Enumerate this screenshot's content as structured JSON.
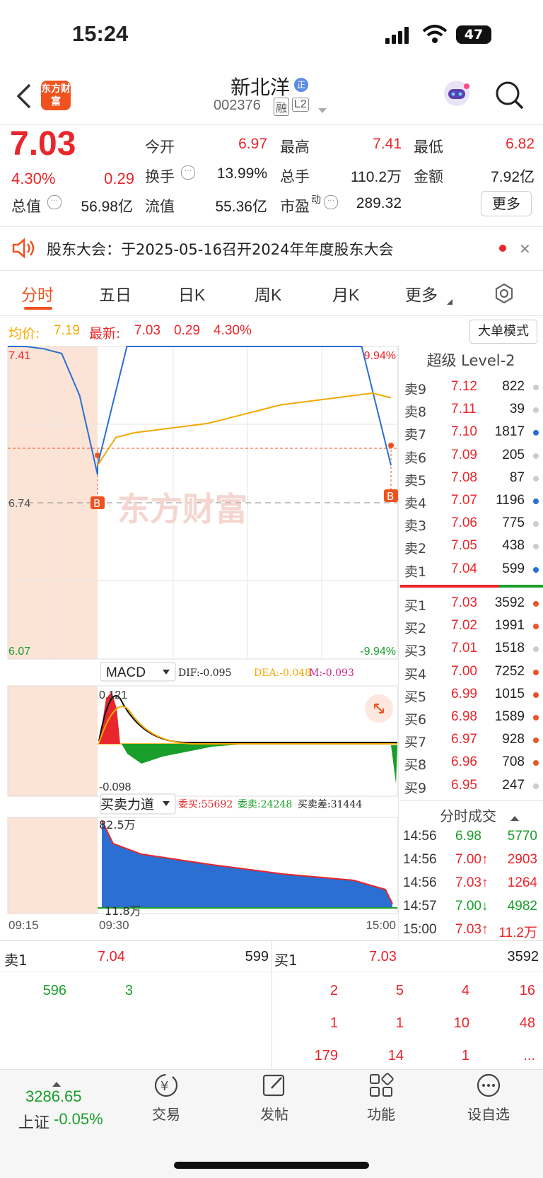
{
  "status_bar": {
    "time": "15:24",
    "battery": "47"
  },
  "header": {
    "logo": "东方财富",
    "name": "新北洋",
    "badge": "正",
    "code": "002376",
    "tag1": "融",
    "tag2": "L2"
  },
  "quote": {
    "price": "7.03",
    "pct": "4.30%",
    "change": "0.29",
    "open_label": "今开",
    "open": "6.97",
    "high_label": "最高",
    "high": "7.41",
    "low_label": "最低",
    "low": "6.82",
    "turnover_label": "换手",
    "turnover": "13.99%",
    "volume_label": "总手",
    "volume": "110.2万",
    "amount_label": "金额",
    "amount": "7.92亿",
    "mktcap_label": "总值",
    "mktcap": "56.98亿",
    "float_label": "流值",
    "float": "55.36亿",
    "pe_label": "市盈",
    "pe_sup": "动",
    "pe": "289.32",
    "more": "更多"
  },
  "notice": {
    "text": "股东大会：于2025-05-16召开2024年年度股东大会"
  },
  "tabs": [
    "分时",
    "五日",
    "日K",
    "周K",
    "月K",
    "更多"
  ],
  "info_line": {
    "avg_label": "均价:",
    "avg": "7.19",
    "latest_label": "最新:",
    "latest": "7.03",
    "chg": "0.29",
    "pct": "4.30%",
    "big_order_button": "大单模式"
  },
  "chart_data": {
    "type": "line",
    "ylim": [
      6.07,
      7.41
    ],
    "y_top_label": "7.41",
    "y_mid_label": "6.74",
    "y_bottom_label": "6.07",
    "pct_top": "9.94%",
    "pct_bottom": "-9.94%",
    "x_labels": [
      "09:15",
      "09:30",
      "15:00"
    ],
    "watermark": "东方财富",
    "price_series": [
      7.41,
      7.41,
      7.4,
      7.38,
      7.2,
      6.86,
      6.9,
      7.41,
      7.41,
      7.41,
      7.41,
      7.41,
      7.41,
      7.41,
      7.41,
      7.41,
      6.9
    ],
    "avg_series": [
      6.9,
      7.02,
      7.04,
      7.05,
      7.06,
      7.07,
      7.08,
      7.1,
      7.12,
      7.14,
      7.16,
      7.17,
      7.18,
      7.19,
      7.2,
      7.21,
      7.19
    ],
    "marker": "B",
    "indicator": {
      "name": "MACD",
      "dif": "DIF:-0.095",
      "dea": "DEA:-0.048",
      "m": "M:-0.093",
      "top": "0.121",
      "bottom": "-0.098"
    },
    "force": {
      "name": "买卖力道",
      "buy": "委买:55692",
      "sell": "委卖:24248",
      "diff": "买卖差:31444",
      "top": "82.5万",
      "bottom": "11.8万"
    }
  },
  "level2": {
    "title": "超级 Level-2",
    "asks": [
      {
        "label": "卖9",
        "price": "7.12",
        "vol": "822",
        "dot": "#cccccc"
      },
      {
        "label": "卖8",
        "price": "7.11",
        "vol": "39",
        "dot": "#cccccc"
      },
      {
        "label": "卖7",
        "price": "7.10",
        "vol": "1817",
        "dot": "#2a6fd1"
      },
      {
        "label": "卖6",
        "price": "7.09",
        "vol": "205",
        "dot": "#cccccc"
      },
      {
        "label": "卖5",
        "price": "7.08",
        "vol": "87",
        "dot": "#cccccc"
      },
      {
        "label": "卖4",
        "price": "7.07",
        "vol": "1196",
        "dot": "#2a6fd1"
      },
      {
        "label": "卖3",
        "price": "7.06",
        "vol": "775",
        "dot": "#cccccc"
      },
      {
        "label": "卖2",
        "price": "7.05",
        "vol": "438",
        "dot": "#cccccc"
      },
      {
        "label": "卖1",
        "price": "7.04",
        "vol": "599",
        "dot": "#2a6fd1"
      }
    ],
    "bids": [
      {
        "label": "买1",
        "price": "7.03",
        "vol": "3592",
        "dot": "#e8562b"
      },
      {
        "label": "买2",
        "price": "7.02",
        "vol": "1991",
        "dot": "#e8562b"
      },
      {
        "label": "买3",
        "price": "7.01",
        "vol": "1518",
        "dot": "#cccccc"
      },
      {
        "label": "买4",
        "price": "7.00",
        "vol": "7252",
        "dot": "#e8562b"
      },
      {
        "label": "买5",
        "price": "6.99",
        "vol": "1015",
        "dot": "#e8562b"
      },
      {
        "label": "买6",
        "price": "6.98",
        "vol": "1589",
        "dot": "#e8562b"
      },
      {
        "label": "买7",
        "price": "6.97",
        "vol": "928",
        "dot": "#e8562b"
      },
      {
        "label": "买8",
        "price": "6.96",
        "vol": "708",
        "dot": "#e8562b"
      },
      {
        "label": "买9",
        "price": "6.95",
        "vol": "247",
        "dot": "#cccccc"
      }
    ],
    "trades_title": "分时成交",
    "trades": [
      {
        "time": "14:56",
        "price": "6.98",
        "vol": "5770",
        "color": "#1a9e2a"
      },
      {
        "time": "14:56",
        "price": "7.00↑",
        "vol": "2903",
        "color": "#e8262b"
      },
      {
        "time": "14:56",
        "price": "7.03↑",
        "vol": "1264",
        "color": "#e8262b"
      },
      {
        "time": "14:57",
        "price": "7.00↓",
        "vol": "4982",
        "color": "#1a9e2a"
      },
      {
        "time": "15:00",
        "price": "7.03↑",
        "vol": "11.2万",
        "color": "#e8262b"
      }
    ]
  },
  "queue": {
    "sell_label": "卖1",
    "sell_price": "7.04",
    "sell_vol": "599",
    "buy_label": "买1",
    "buy_price": "7.03",
    "buy_vol": "3592",
    "sell_orders": [
      "596",
      "3"
    ],
    "buy_orders": [
      "2",
      "5",
      "4",
      "16",
      "1",
      "1",
      "10",
      "48",
      "179",
      "14",
      "1",
      "..."
    ]
  },
  "bottom_nav": {
    "index_value": "3286.65",
    "index_name": "上证",
    "index_pct": "-0.05%",
    "items": [
      "交易",
      "发帖",
      "功能",
      "设自选"
    ]
  }
}
